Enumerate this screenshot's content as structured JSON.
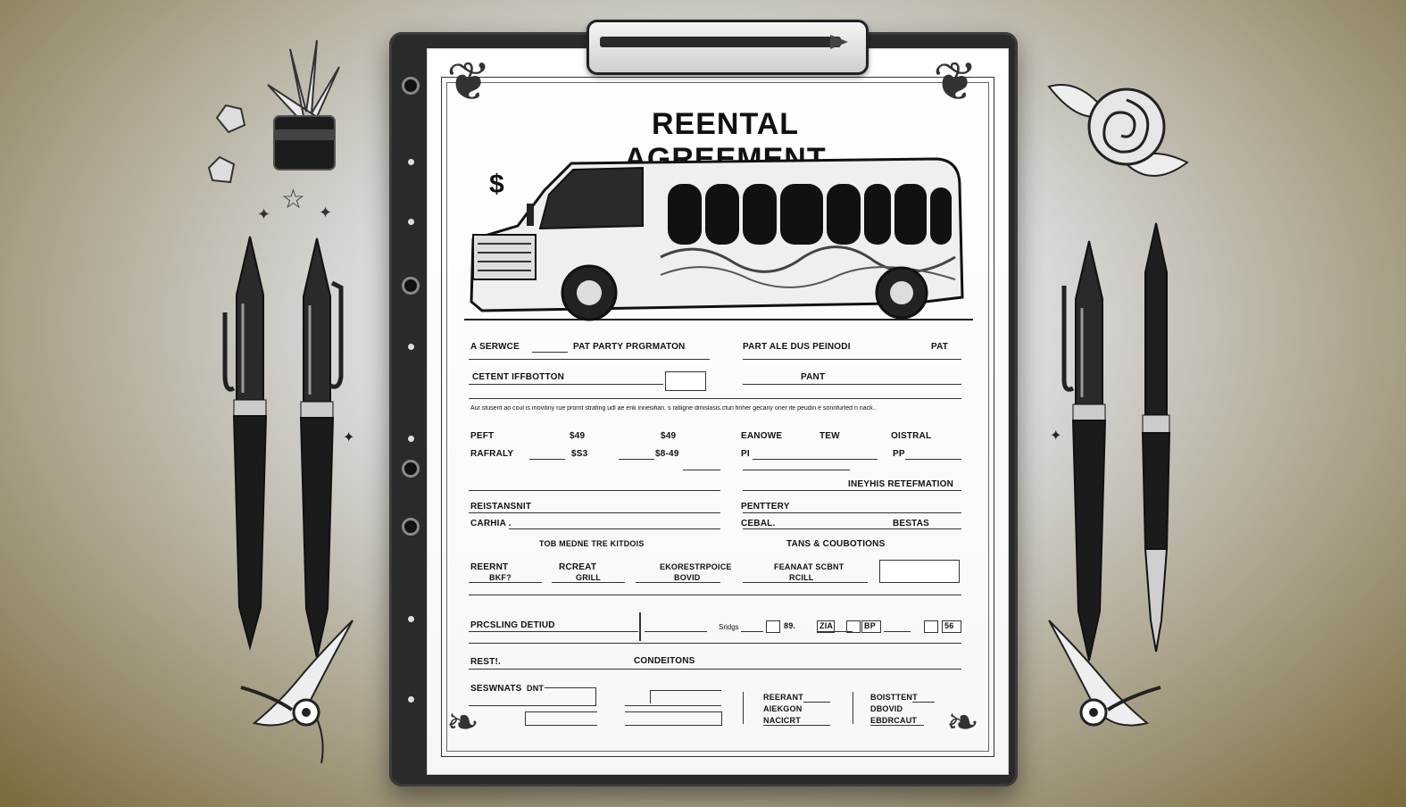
{
  "document": {
    "title": "REENTAL AGREEMENT",
    "dollar_sign": "$",
    "section1": {
      "a_service": "A SERWCE",
      "party": "PAT PARTY PRGRMATON",
      "due": "PART ALE DUS PEINODI",
      "pat": "PAT",
      "client": "CETENT IFFBOTTON",
      "pant": "PANT"
    },
    "paragraph": "Aur stusent ao coul is moviliny rue prornt strafing udl ae enk innesifian, s ralligne dmislasis.ctun finher gecany oner ite peudin e sonnfurted n nack..",
    "pricing_rows": {
      "row1": {
        "label": "PEFT",
        "v1": "$49",
        "v2": "$49",
        "r1": "EANOWE",
        "r2": "TEW",
        "r3": "OISTRAL"
      },
      "row2": {
        "label": "RAFRALY",
        "v1": "$S3",
        "v2": "$8-49",
        "r1": "PI",
        "r3": "PP"
      }
    },
    "info_header": "INEYHIS RETEFMATION",
    "reservation": {
      "l1": "REISTANSNIT",
      "l2": "CARHIA .",
      "r1": "PENTTERY",
      "r2": "CEBAL.",
      "r3": "BESTAS"
    },
    "terms": {
      "left": "TOB MEDNE TRE KITDOIS",
      "right": "TANS & COUBOTIONS"
    },
    "sig_row": {
      "c1a": "REERNT",
      "c1b": "BKF?",
      "c2a": "RCREAT",
      "c2b": "GRILL",
      "c3a": "EKORESTRPOICE",
      "c3b": "BOVID",
      "c4a": "FEANAAT SCBNT",
      "c4b": "RCILL"
    },
    "pricing": {
      "label": "PRCSLING DETIUD",
      "c1": "Sridgs",
      "c2": "89.",
      "c3": "ZIA",
      "c4": "BP",
      "c5": "56"
    },
    "bottom": {
      "rest": "REST!.",
      "conditions": "CONDEITONS",
      "servants": "SESWNATS",
      "dnt": "DNT",
      "mid1": "REERANT",
      "mid2": "AIEKGON",
      "mid3": "NACICRT",
      "right1": "BOISTTENT",
      "right2": "DBOVID",
      "right3": "EBDRCAUT"
    }
  }
}
